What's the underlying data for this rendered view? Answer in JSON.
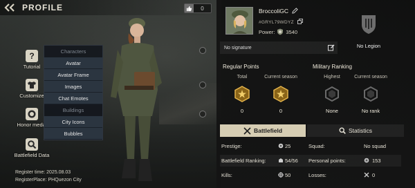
{
  "header": {
    "title": "PROFILE",
    "counter": "0"
  },
  "side_nav": [
    {
      "label": "Tutorial"
    },
    {
      "label": "Customize"
    },
    {
      "label": "Honor medal"
    },
    {
      "label": "Battlefield Data"
    }
  ],
  "menu": {
    "characters_heading": "Characters",
    "character_items": [
      "Avatar",
      "Avatar Frame",
      "Images",
      "Chat Emotes"
    ],
    "buildings_heading": "Buildings",
    "building_items": [
      "City Icons",
      "Bubbles"
    ]
  },
  "registration": {
    "time_label": "Register time:",
    "time_value": "2025.08.03",
    "place_label": "RegisterPlace:",
    "place_value": "PHQuezon City"
  },
  "player": {
    "name": "BroccoliGC",
    "uid": "#GRYL79WDYZ",
    "power_label": "Power:",
    "power_value": "3540",
    "signature": "No signature"
  },
  "legion": {
    "label": "No Legion"
  },
  "regular_points": {
    "title": "Regular Points",
    "total_label": "Total",
    "total_value": "0",
    "season_label": "Current season",
    "season_value": "0"
  },
  "military_ranking": {
    "title": "Military Ranking",
    "highest_label": "Highest",
    "highest_value": "None",
    "season_label": "Current season",
    "season_value": "No rank"
  },
  "tabs": {
    "battlefield": "Battlefield",
    "statistics": "Statistics"
  },
  "stats": {
    "prestige_label": "Prestige:",
    "prestige_value": "25",
    "squad_label": "Squad:",
    "squad_value": "No squad",
    "ranking_label": "Battlefield Ranking:",
    "ranking_value": "54/56",
    "personal_label": "Personal points:",
    "personal_value": "153",
    "kills_label": "Kills:",
    "kills_value": "50",
    "losses_label": "Losses:",
    "losses_value": "0"
  },
  "colors": {
    "accent": "#d6cdb3",
    "gold": "#d9a53a",
    "panel": "#141414"
  }
}
